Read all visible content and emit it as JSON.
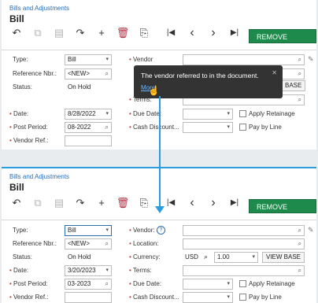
{
  "top": {
    "breadcrumb": "Bills and Adjustments",
    "title": "Bill",
    "remove_hold": "REMOVE HOLD",
    "type_label": "Type:",
    "type_value": "Bill",
    "ref_label": "Reference Nbr.:",
    "ref_value": "<NEW>",
    "status_label": "Status:",
    "status_value": "On Hold",
    "date_label": "Date:",
    "date_value": "8/28/2022",
    "period_label": "Post Period:",
    "period_value": "08-2022",
    "vendor_ref_label": "Vendor Ref.:",
    "vendor_label": "Vendor",
    "base_button": "BASE",
    "terms_label": "Terms:",
    "due_date_label": "Due Date:",
    "cash_discount_label": "Cash Discount...",
    "apply_retainage_label": "Apply Retainage",
    "pay_by_line_label": "Pay by Line",
    "tooltip_text": "The vendor referred to in the document.",
    "tooltip_link": "More"
  },
  "bottom": {
    "breadcrumb": "Bills and Adjustments",
    "title": "Bill",
    "remove_hold": "REMOVE HOLD",
    "type_label": "Type:",
    "type_value": "Bill",
    "ref_label": "Reference Nbr.:",
    "ref_value": "<NEW>",
    "status_label": "Status:",
    "status_value": "On Hold",
    "date_label": "Date:",
    "date_value": "3/20/2023",
    "period_label": "Post Period:",
    "period_value": "03-2023",
    "vendor_ref_label": "Vendor Ref.:",
    "vendor_label": "Vendor:",
    "location_label": "Location:",
    "currency_label": "Currency:",
    "currency_value": "USD",
    "rate_value": "1.00",
    "view_base_button": "VIEW BASE",
    "terms_label": "Terms:",
    "due_date_label": "Due Date:",
    "cash_discount_label": "Cash Discount...",
    "apply_retainage_label": "Apply Retainage",
    "pay_by_line_label": "Pay by Line"
  },
  "icons": {
    "undo": "↶",
    "copy": "⧉",
    "save": "▤",
    "redo": "↷",
    "add": "+",
    "delete": "🗑",
    "copy_menu": "⎘",
    "first": "|◀",
    "prev": "‹",
    "next": "›",
    "last": "▶|",
    "search": "⌕",
    "caret": "▾",
    "pencil": "✎",
    "info": "?",
    "close": "✕",
    "cursor": "☝"
  }
}
